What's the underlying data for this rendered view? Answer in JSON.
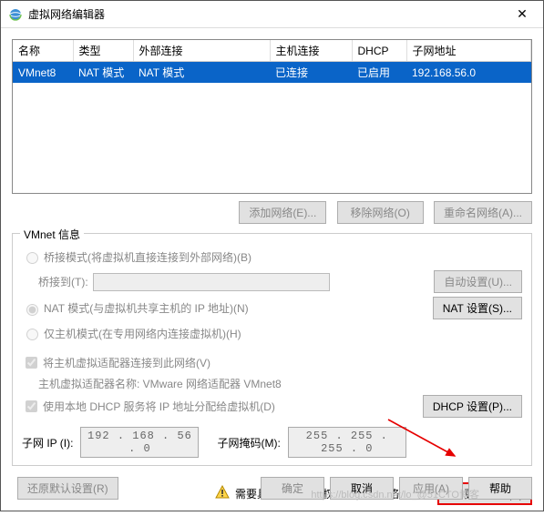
{
  "window": {
    "title": "虚拟网络编辑器"
  },
  "table": {
    "headers": [
      "名称",
      "类型",
      "外部连接",
      "主机连接",
      "DHCP",
      "子网地址"
    ],
    "row": {
      "name": "VMnet8",
      "type": "NAT 模式",
      "external": "NAT 模式",
      "host": "已连接",
      "dhcp": "已启用",
      "subnet": "192.168.56.0"
    }
  },
  "buttons": {
    "add_network": "添加网络(E)...",
    "remove_network": "移除网络(O)",
    "rename_network": "重命名网络(A)...",
    "auto_set": "自动设置(U)...",
    "nat_set": "NAT 设置(S)...",
    "dhcp_set": "DHCP 设置(P)...",
    "change": "更改设置(C)",
    "restore": "还原默认设置(R)",
    "ok": "确定",
    "cancel": "取消",
    "apply": "应用(A)",
    "help": "帮助"
  },
  "group": {
    "title": "VMnet 信息",
    "bridge": "桥接模式(将虚拟机直接连接到外部网络)(B)",
    "bridge_to": "桥接到(T):",
    "nat": "NAT 模式(与虚拟机共享主机的 IP 地址)(N)",
    "hostonly": "仅主机模式(在专用网络内连接虚拟机)(H)",
    "connect_host": "将主机虚拟适配器连接到此网络(V)",
    "adapter_name": "主机虚拟适配器名称: VMware 网络适配器 VMnet8",
    "use_dhcp": "使用本地 DHCP 服务将 IP 地址分配给虚拟机(D)",
    "subnet_ip_label": "子网 IP (I):",
    "subnet_ip": "192 . 168 . 56 .  0",
    "subnet_mask_label": "子网掩码(M):",
    "subnet_mask": "255 . 255 . 255 .  0"
  },
  "warning": "需要具备管理员特权才能修改网络配置。",
  "watermark": "https://blog.csdn.net/lo_@51CTO博客"
}
